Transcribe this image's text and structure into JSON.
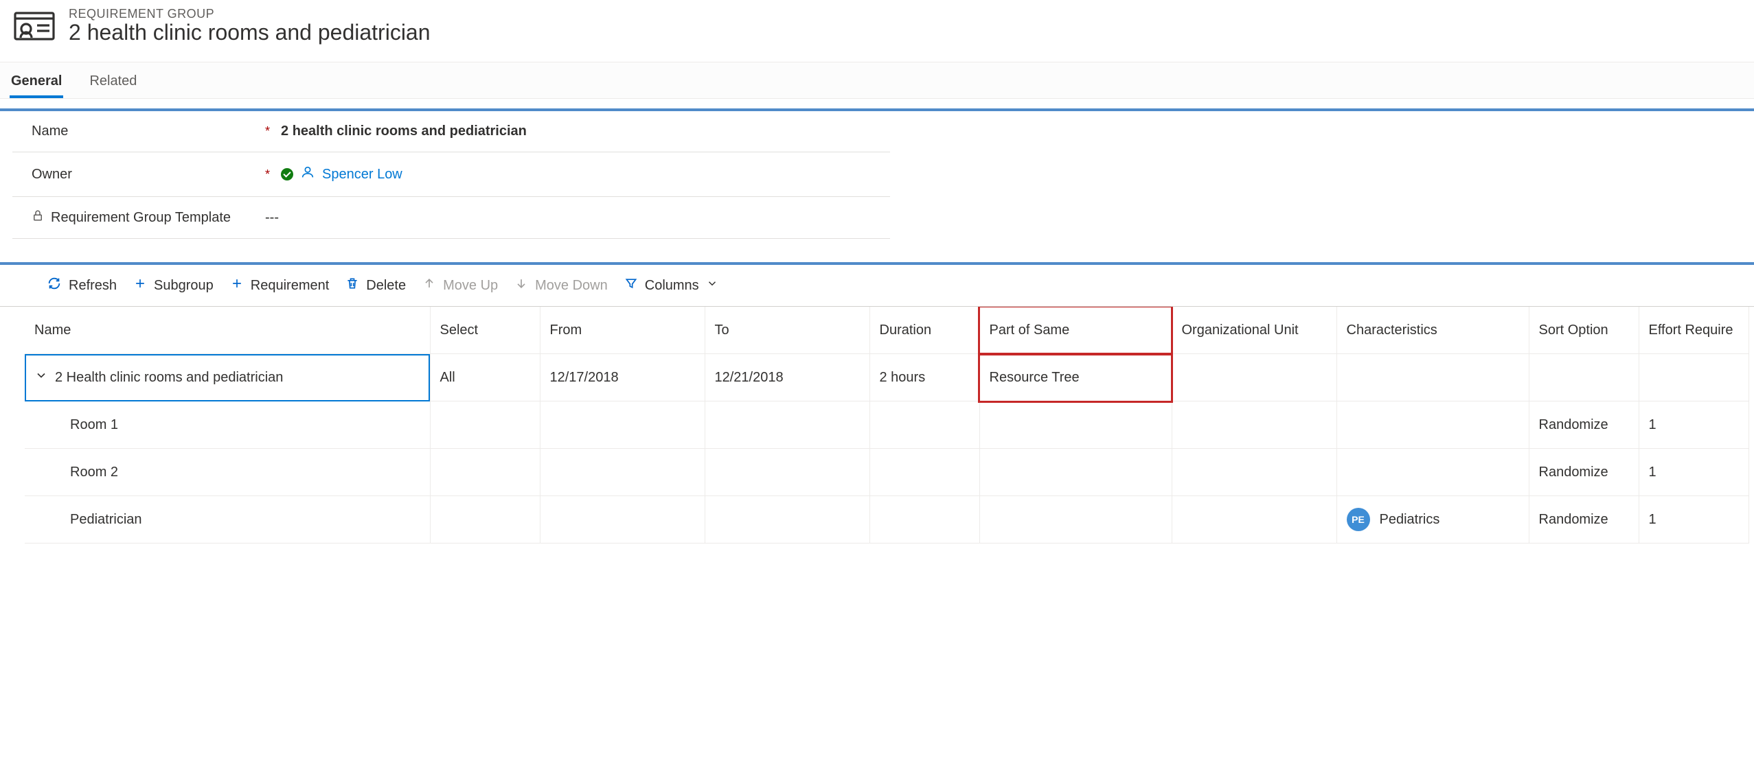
{
  "header": {
    "entity_label": "REQUIREMENT GROUP",
    "record_title": "2 health clinic rooms and pediatrician"
  },
  "tabs": {
    "general": "General",
    "related": "Related"
  },
  "form": {
    "name": {
      "label": "Name",
      "required": true,
      "value": "2 health clinic rooms and pediatrician"
    },
    "owner": {
      "label": "Owner",
      "required": true,
      "value": "Spencer Low"
    },
    "template": {
      "label": "Requirement Group Template",
      "required": false,
      "value": "---",
      "locked": true
    }
  },
  "grid_toolbar": {
    "refresh": "Refresh",
    "subgroup": "Subgroup",
    "requirement": "Requirement",
    "delete": "Delete",
    "move_up": "Move Up",
    "move_down": "Move Down",
    "columns": "Columns"
  },
  "grid": {
    "columns": {
      "name": "Name",
      "select": "Select",
      "from": "From",
      "to": "To",
      "duration": "Duration",
      "part_of_same": "Part of Same",
      "org_unit": "Organizational Unit",
      "characteristics": "Characteristics",
      "sort_option": "Sort Option",
      "effort_required": "Effort Require"
    },
    "rows": [
      {
        "type": "group",
        "name": "2 Health clinic rooms and pediatrician",
        "select": "All",
        "from": "12/17/2018",
        "to": "12/21/2018",
        "duration": "2 hours",
        "part_of_same": "Resource Tree",
        "org_unit": "",
        "characteristic_badge": "",
        "characteristic_text": "",
        "sort_option": "",
        "effort_required": ""
      },
      {
        "type": "child",
        "name": "Room 1",
        "select": "",
        "from": "",
        "to": "",
        "duration": "",
        "part_of_same": "",
        "org_unit": "",
        "characteristic_badge": "",
        "characteristic_text": "",
        "sort_option": "Randomize",
        "effort_required": "1"
      },
      {
        "type": "child",
        "name": "Room 2",
        "select": "",
        "from": "",
        "to": "",
        "duration": "",
        "part_of_same": "",
        "org_unit": "",
        "characteristic_badge": "",
        "characteristic_text": "",
        "sort_option": "Randomize",
        "effort_required": "1"
      },
      {
        "type": "child",
        "name": "Pediatrician",
        "select": "",
        "from": "",
        "to": "",
        "duration": "",
        "part_of_same": "",
        "org_unit": "",
        "characteristic_badge": "PE",
        "characteristic_text": "Pediatrics",
        "sort_option": "Randomize",
        "effort_required": "1"
      }
    ]
  }
}
